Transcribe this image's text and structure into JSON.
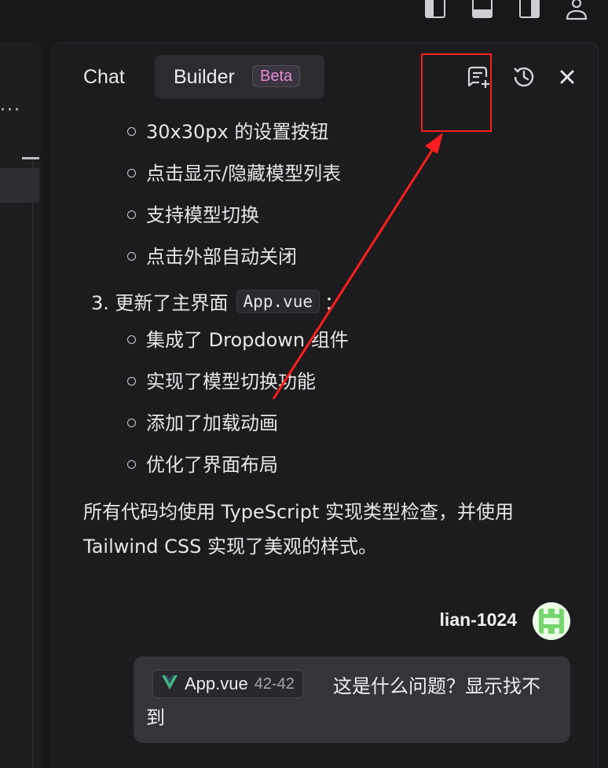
{
  "chat": {
    "tabs": {
      "chat": "Chat",
      "builder": "Builder",
      "beta_badge": "Beta"
    },
    "message": {
      "bullets_group1": [
        "30x30px 的设置按钮",
        "点击显示/隐藏模型列表",
        "支持模型切换",
        "点击外部自动关闭"
      ],
      "numbered_item": {
        "prefix": "3. 更新了主界面",
        "code": "App.vue",
        "suffix": "："
      },
      "bullets_group2": [
        "集成了 Dropdown 组件",
        "实现了模型切换功能",
        "添加了加载动画",
        "优化了界面布局"
      ],
      "paragraph": "所有代码均使用 TypeScript 实现类型检查，并使用 Tailwind CSS 实现了美观的样式。"
    },
    "user": {
      "name": "lian-1024",
      "file_chip": {
        "name": "App.vue",
        "lines": "42-42"
      },
      "text": "这是什么问题？显示找不到"
    }
  },
  "icons": {
    "header": [
      "new-chat-icon",
      "history-icon",
      "close-icon"
    ],
    "window": [
      "layout-left-icon",
      "layout-bottom-icon",
      "layout-right-icon",
      "account-icon"
    ]
  },
  "colors": {
    "annotation": "#ff1d1d",
    "beta_text": "#e58bd3",
    "vue_green": "#41b883"
  }
}
